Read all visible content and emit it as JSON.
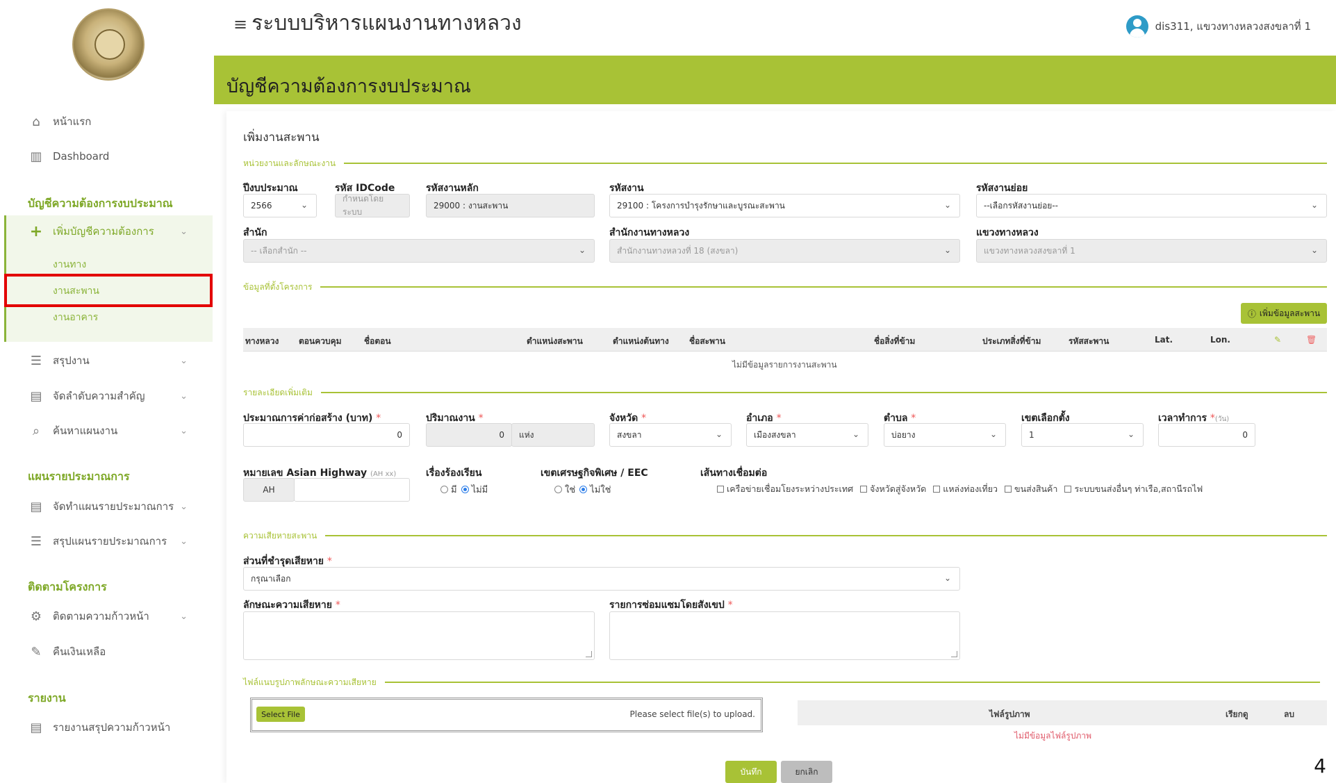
{
  "sidebar": {
    "home": "หน้าแรก",
    "dashboard": "Dashboard",
    "section_budget": "บัญชีความต้องการงบประมาณ",
    "add_budget": "เพิ่มบัญชีความต้องการ",
    "sub_road": "งานทาง",
    "sub_bridge": "งานสะพาน",
    "sub_building": "งานอาคาร",
    "summary": "สรุปงาน",
    "priority": "จัดลำดับความสำคัญ",
    "search_plan": "ค้นหาแผนงาน",
    "section_plan": "แผนรายประมาณการ",
    "make_plan": "จัดทำแผนรายประมาณการ",
    "summary_plan": "สรุปแผนรายประมาณการ",
    "section_track": "ติดตามโครงการ",
    "track_progress": "ติดตามความก้าวหน้า",
    "refund": "คืนเงินเหลือ",
    "section_report": "รายงาน",
    "report_progress": "รายงานสรุปความก้าวหน้า"
  },
  "header": {
    "title": "ระบบบริหารแผนงานทางหลวง",
    "user": "dis311, แขวงทางหลวงสงขลาที่ 1"
  },
  "banner": "บัญชีความต้องการงบประมาณ",
  "form": {
    "title": "เพิ่มงานสะพาน",
    "legend_unit": "หน่วยงานและลักษณะงาน",
    "fiscal_year_label": "ปีงบประมาณ",
    "fiscal_year": "2566",
    "idcode_label": "รหัส IDCode",
    "idcode_ph": "กำหนดโดยระบบ",
    "main_code_label": "รหัสงานหลัก",
    "main_code": "29000 : งานสะพาน",
    "work_code_label": "รหัสงาน",
    "work_code": "29100 : โครงการบำรุงรักษาและบูรณะสะพาน",
    "sub_code_label": "รหัสงานย่อย",
    "sub_code": "--เลือกรหัสงานย่อย--",
    "bureau_label": "สำนัก",
    "bureau": "-- เลือกสำนัก --",
    "office_label": "สำนักงานทางหลวง",
    "office": "สำนักงานทางหลวงที่ 18 (สงขลา)",
    "district_label": "แขวงทางหลวง",
    "district": "แขวงทางหลวงสงขลาที่ 1",
    "legend_location": "ข้อมูลที่ตั้งโครงการ",
    "add_bridge_btn": "เพิ่มข้อมูลสะพาน",
    "table_headers": [
      "ทางหลวง",
      "ตอนควบคุม",
      "ชื่อตอน",
      "ตำแหน่งสะพาน",
      "ตำแหน่งต้นทาง",
      "ชื่อสะพาน",
      "ชื่อสิ่งที่ข้าม",
      "ประเภทสิ่งที่ข้าม",
      "รหัสสะพาน",
      "Lat.",
      "Lon."
    ],
    "table_empty": "ไม่มีข้อมูลรายการงานสะพาน",
    "legend_extra": "รายละเอียดเพิ่มเติม",
    "cost_label": "ประมาณการค่าก่อสร้าง (บาท)",
    "cost": "0",
    "qty_label": "ปริมาณงาน",
    "qty": "0",
    "qty_unit": "แห่ง",
    "province_label": "จังหวัด",
    "province": "สงขลา",
    "amphoe_label": "อำเภอ",
    "amphoe": "เมืองสงขลา",
    "tambon_label": "ตำบล",
    "tambon": "บ่อยาง",
    "constituency_label": "เขตเลือกตั้ง",
    "constituency": "1",
    "duration_label": "เวลาทำการ",
    "duration_unit": "(วัน)",
    "duration": "0",
    "ah_label": "หมายเลข Asian Highway",
    "ah_hint": "(AH xx)",
    "ah_prefix": "AH",
    "complaint_label": "เรื่องร้องเรียน",
    "complaint_yes": "มี",
    "complaint_no": "ไม่มี",
    "eec_label": "เขตเศรษฐกิจพิเศษ / EEC",
    "eec_yes": "ใช่",
    "eec_no": "ไม่ใช่",
    "link_label": "เส้นทางเชื่อมต่อ",
    "link_options": [
      "เครือข่ายเชื่อมโยงระหว่างประเทศ",
      "จังหวัดสู่จังหวัด",
      "แหล่งท่องเที่ยว",
      "ขนส่งสินค้า",
      "ระบบขนส่งอื่นๆ ท่าเรือ,สถานีรถไฟ"
    ],
    "legend_damage": "ความเสียหายสะพาน",
    "damaged_part_label": "ส่วนที่ชำรุดเสียหาย",
    "damaged_part": "กรุณาเลือก",
    "damage_desc_label": "ลักษณะความเสียหาย",
    "repair_label": "รายการซ่อมแซมโดยสังเขป",
    "legend_files": "ไฟล์แนบรูปภาพลักษณะความเสียหาย",
    "select_file": "Select File",
    "upload_hint": "Please select file(s) to upload.",
    "file_col": "ไฟล์รูปภาพ",
    "view_col": "เรียกดู",
    "del_col": "ลบ",
    "file_empty": "ไม่มีข้อมูลไฟล์รูปภาพ",
    "save": "บันทึก",
    "cancel": "ยกเลิก"
  },
  "page_number": "4",
  "colors": {
    "accent": "#a8c236",
    "highlight": "#e30000"
  }
}
